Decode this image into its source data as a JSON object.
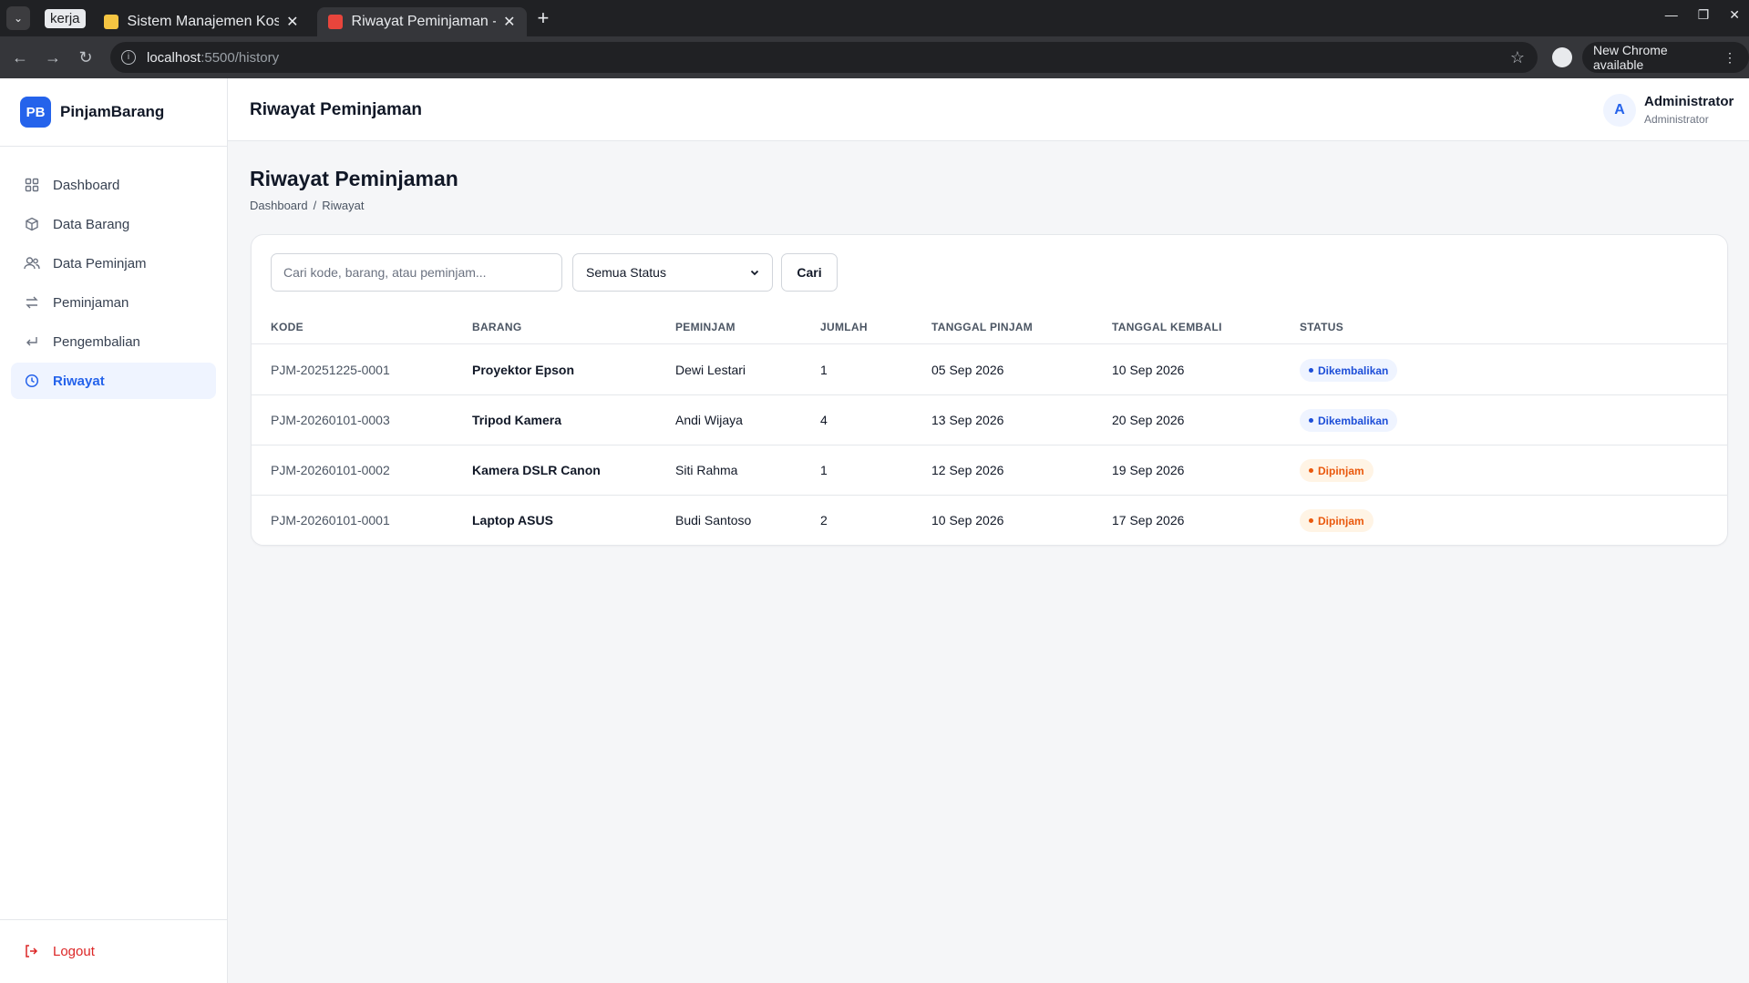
{
  "browser": {
    "tab_group": "kerja",
    "tabs": [
      {
        "title": "Sistem Manajemen Kos"
      },
      {
        "title": "Riwayat Peminjaman - P"
      }
    ],
    "url_host": "localhost",
    "url_path": ":5500/history",
    "update_label": "New Chrome available"
  },
  "sidebar": {
    "logo": "PB",
    "brand": "PinjamBarang",
    "items": [
      {
        "label": "Dashboard"
      },
      {
        "label": "Data Barang"
      },
      {
        "label": "Data Peminjam"
      },
      {
        "label": "Peminjaman"
      },
      {
        "label": "Pengembalian"
      },
      {
        "label": "Riwayat"
      }
    ],
    "logout": "Logout"
  },
  "header": {
    "title": "Riwayat Peminjaman",
    "avatar": "A",
    "user_name": "Administrator",
    "user_role": "Administrator"
  },
  "page": {
    "title": "Riwayat Peminjaman",
    "breadcrumb": [
      "Dashboard",
      "/",
      "Riwayat"
    ]
  },
  "filters": {
    "search_placeholder": "Cari kode, barang, atau peminjam...",
    "status_selected": "Semua Status",
    "search_button": "Cari"
  },
  "table": {
    "headers": [
      "KODE",
      "BARANG",
      "PEMINJAM",
      "JUMLAH",
      "TANGGAL PINJAM",
      "TANGGAL KEMBALI",
      "STATUS"
    ],
    "rows": [
      {
        "kode": "PJM-20251225-0001",
        "barang": "Proyektor Epson",
        "peminjam": "Dewi Lestari",
        "jumlah": "1",
        "tgl_pinjam": "05 Sep 2026",
        "tgl_kembali": "10 Sep 2026",
        "status": "Dikembalikan"
      },
      {
        "kode": "PJM-20260101-0003",
        "barang": "Tripod Kamera",
        "peminjam": "Andi Wijaya",
        "jumlah": "4",
        "tgl_pinjam": "13 Sep 2026",
        "tgl_kembali": "20 Sep 2026",
        "status": "Dikembalikan"
      },
      {
        "kode": "PJM-20260101-0002",
        "barang": "Kamera DSLR Canon",
        "peminjam": "Siti Rahma",
        "jumlah": "1",
        "tgl_pinjam": "12 Sep 2026",
        "tgl_kembali": "19 Sep 2026",
        "status": "Dipinjam"
      },
      {
        "kode": "PJM-20260101-0001",
        "barang": "Laptop ASUS",
        "peminjam": "Budi Santoso",
        "jumlah": "2",
        "tgl_pinjam": "10 Sep 2026",
        "tgl_kembali": "17 Sep 2026",
        "status": "Dipinjam"
      }
    ]
  },
  "colors": {
    "primary": "#2563eb",
    "status_returned": "#1d4ed8",
    "status_borrowed": "#ea580c",
    "logout": "#dc2626"
  }
}
